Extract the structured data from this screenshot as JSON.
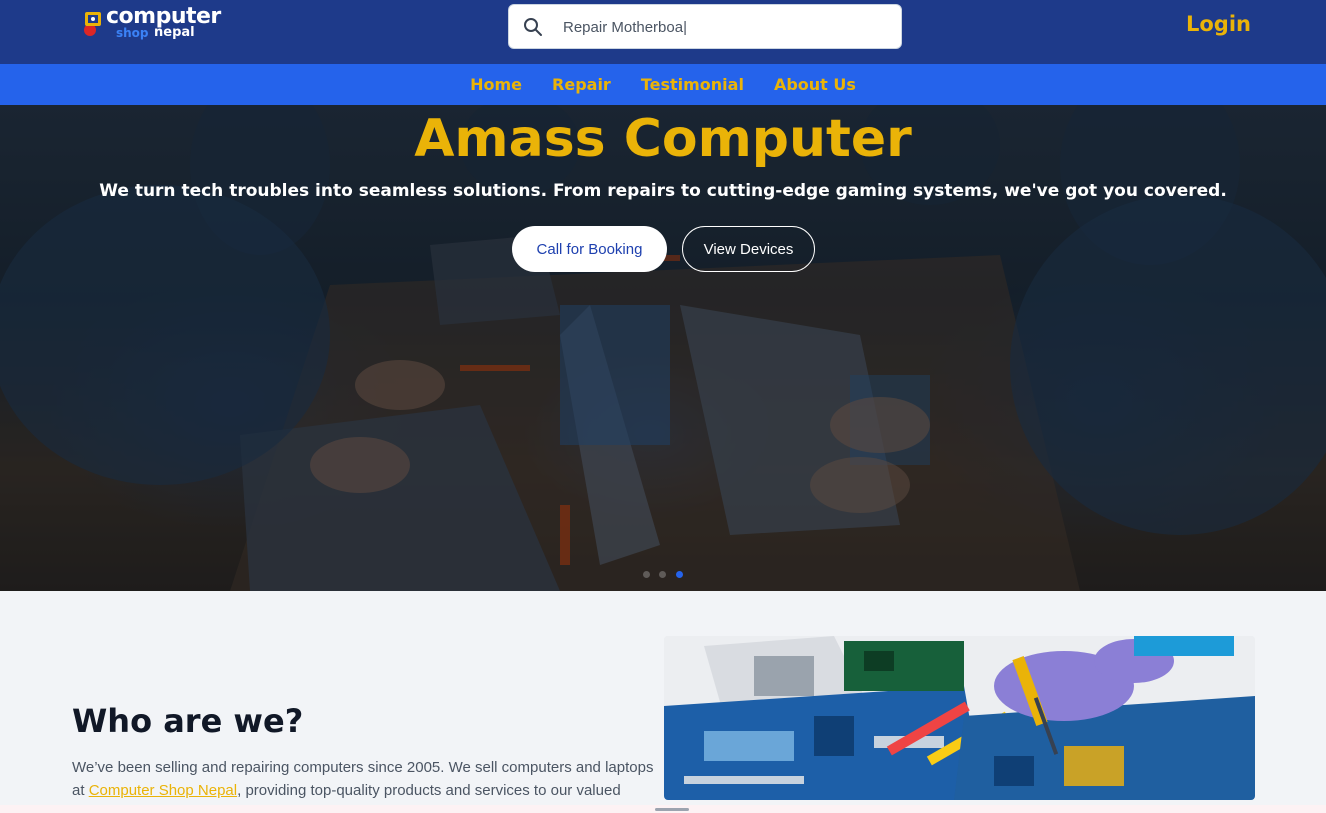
{
  "header": {
    "logo": {
      "word1": "computer",
      "word2": "shop",
      "word3": "nepal"
    },
    "search": {
      "value": "Repair Motherboa|",
      "placeholder": ""
    },
    "login_label": "Login"
  },
  "nav": {
    "items": [
      {
        "label": "Home"
      },
      {
        "label": "Repair"
      },
      {
        "label": "Testimonial"
      },
      {
        "label": "About Us"
      }
    ]
  },
  "hero": {
    "title": "Amass Computer",
    "subtitle": "We turn tech troubles into seamless solutions. From repairs to cutting-edge gaming systems, we've got you covered.",
    "primary_button": "Call for Booking",
    "secondary_button": "View Devices",
    "slides_total": 3,
    "active_slide": 3
  },
  "about": {
    "title": "Who are we?",
    "text_before_link": "We’ve been selling and repairing computers since 2005. We sell computers and laptops at ",
    "link_text": "Computer Shop Nepal",
    "text_after_link": ", providing top-quality products and services to our valued"
  },
  "colors": {
    "header_bg": "#1e3a8a",
    "nav_bg": "#2563eb",
    "accent": "#eab308",
    "active_dot": "#2563eb"
  },
  "icons": {
    "search": "search-icon",
    "logo": "logo-icon"
  }
}
